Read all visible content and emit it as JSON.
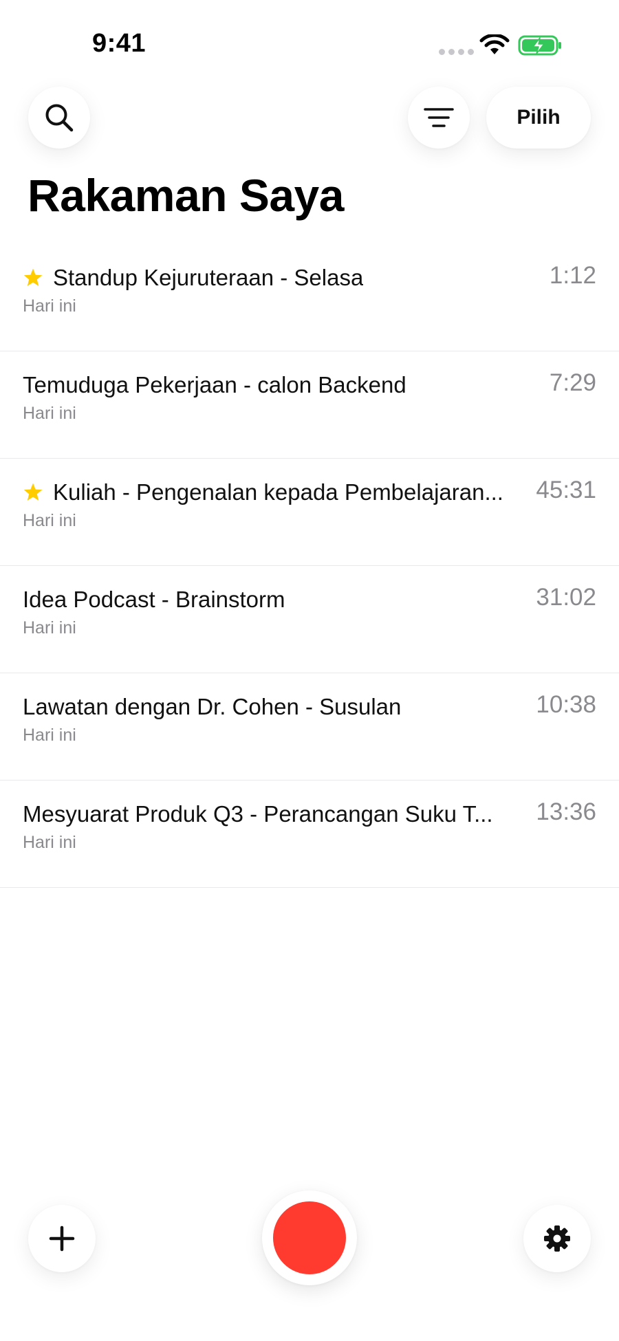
{
  "status_bar": {
    "time": "9:41",
    "icons": [
      "signal-dots-icon",
      "wifi-icon",
      "battery-charging-icon"
    ],
    "battery_color": "#34c759"
  },
  "header": {
    "search_icon": "search-icon",
    "filter_icon": "filter-icon",
    "select_label": "Pilih"
  },
  "title": "Rakaman Saya",
  "recordings": [
    {
      "title": "Standup Kejuruteraan - Selasa",
      "subtitle": "Hari ini",
      "duration": "1:12",
      "starred": true
    },
    {
      "title": "Temuduga Pekerjaan - calon Backend",
      "subtitle": "Hari ini",
      "duration": "7:29",
      "starred": false
    },
    {
      "title": "Kuliah - Pengenalan kepada Pembelajaran...",
      "subtitle": "Hari ini",
      "duration": "45:31",
      "starred": true
    },
    {
      "title": "Idea Podcast - Brainstorm",
      "subtitle": "Hari ini",
      "duration": "31:02",
      "starred": false
    },
    {
      "title": "Lawatan dengan Dr. Cohen - Susulan",
      "subtitle": "Hari ini",
      "duration": "10:38",
      "starred": false
    },
    {
      "title": "Mesyuarat Produk Q3 - Perancangan Suku T...",
      "subtitle": "Hari ini",
      "duration": "13:36",
      "starred": false
    }
  ],
  "bottom_bar": {
    "add_icon": "plus-icon",
    "record_icon": "record-icon",
    "settings_icon": "gear-icon",
    "record_color": "#ff3b30",
    "star_color": "#ffcc00"
  }
}
